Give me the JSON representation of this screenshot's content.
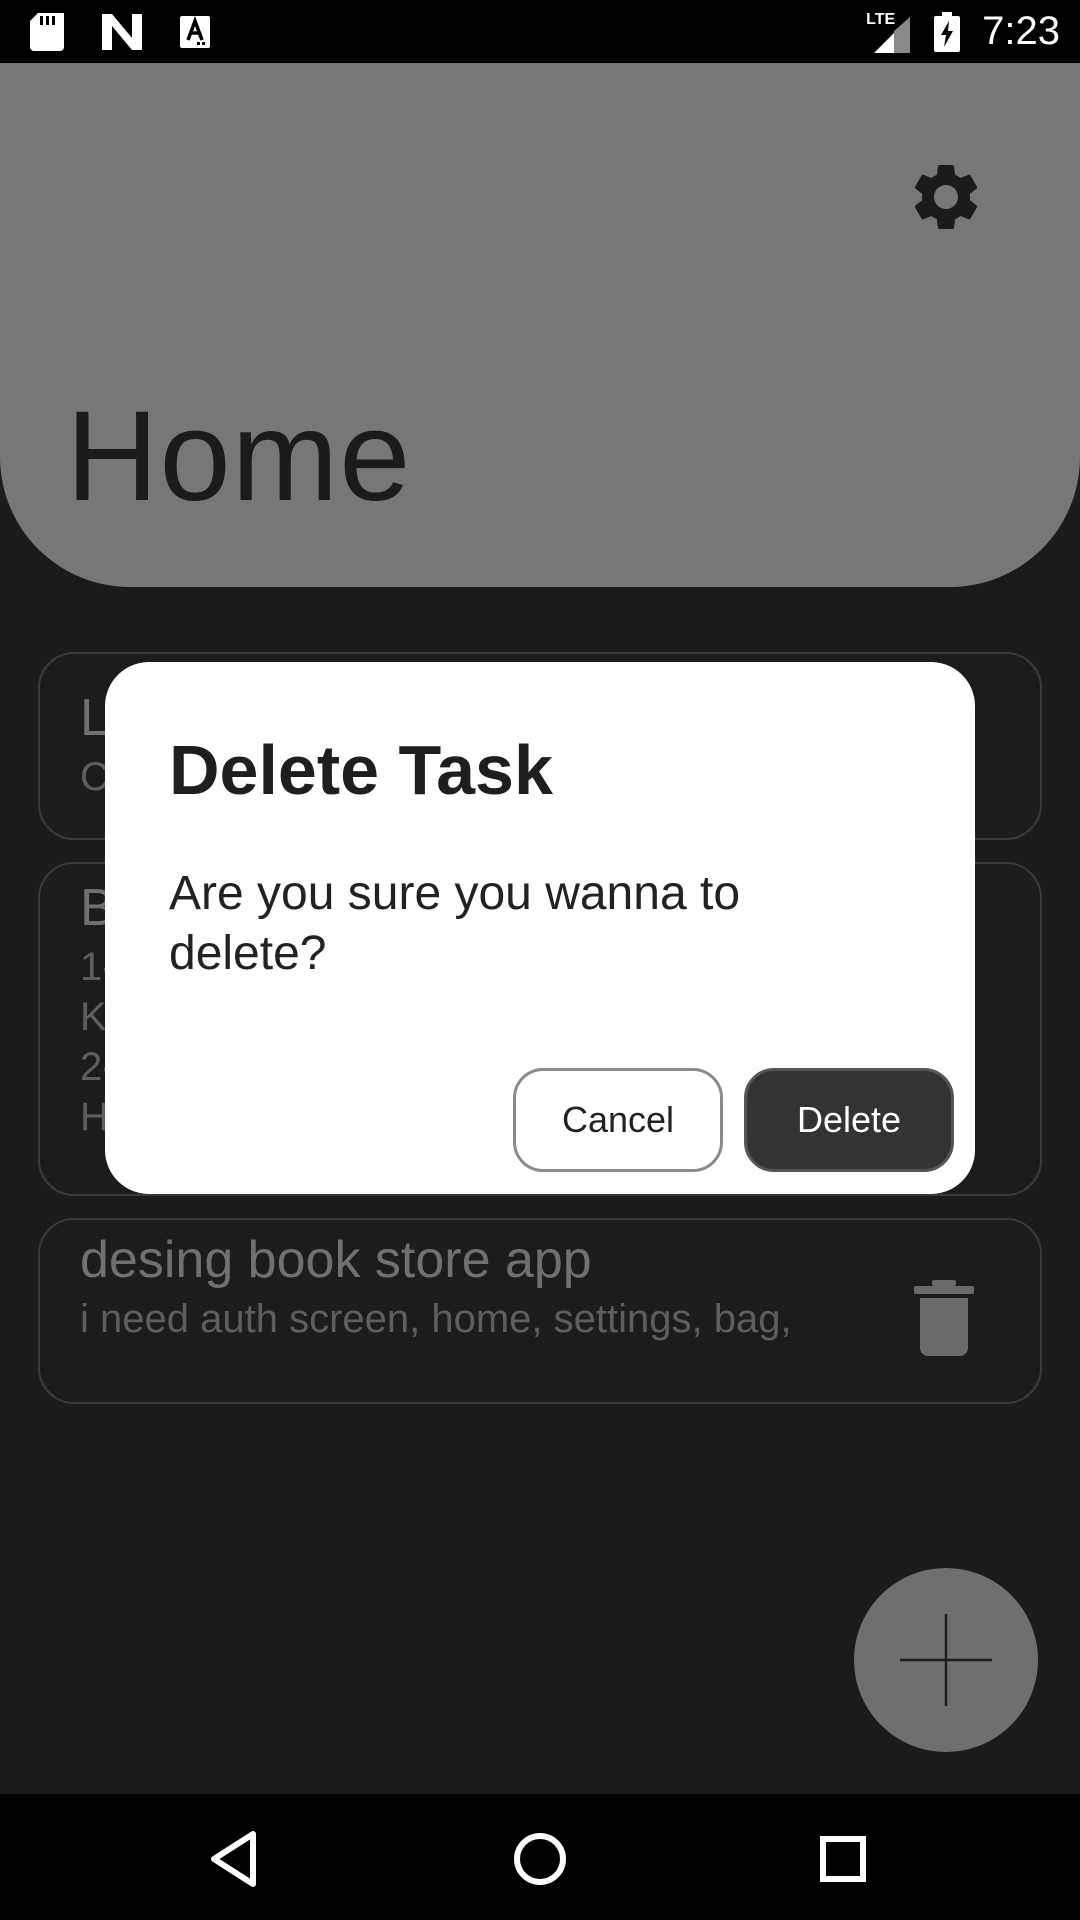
{
  "status_bar": {
    "time": "7:23",
    "network": "LTE",
    "icons": [
      "sd-card-icon",
      "n-notification-icon",
      "a-notification-icon",
      "signal-icon",
      "battery-charging-icon"
    ]
  },
  "header": {
    "title": "Home",
    "settings_icon": "gear-icon",
    "background_color": "#777777"
  },
  "tasks": [
    {
      "title": "L",
      "description_lines": [
        "C"
      ]
    },
    {
      "title": "B",
      "description_lines": [
        "1-",
        "K",
        "2-",
        "H"
      ]
    },
    {
      "title": "desing book store app",
      "description_lines": [
        "i need auth screen, home, settings, bag,"
      ],
      "action_icon": "trash-icon"
    }
  ],
  "fab": {
    "icon": "plus-icon"
  },
  "dialog": {
    "title": "Delete Task",
    "message": "Are you sure you wanna to delete?",
    "cancel_label": "Cancel",
    "confirm_label": "Delete"
  },
  "nav_bar": {
    "icons": [
      "back-icon",
      "home-icon",
      "recents-icon"
    ]
  },
  "colors": {
    "background": "#1b1b1b",
    "dialog_background": "#ffffff",
    "delete_button": "#333333"
  }
}
